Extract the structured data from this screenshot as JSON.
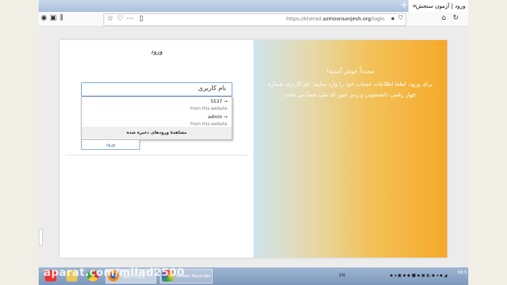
{
  "browser": {
    "tab_title": "ورود | آزمون سنجش - عضویت",
    "tab_close": "×",
    "new_tab": "+",
    "url_prefix": "https://kherad.",
    "url_domain": "azmoonsanjesh.org",
    "url_path": "/login"
  },
  "login": {
    "title": "ورود",
    "username_value": "نام کاربری",
    "autocomplete": [
      {
        "name": "5537",
        "source": "From this website"
      },
      {
        "name": "admin",
        "source": "From this website"
      }
    ],
    "view_saved_logins": "مشاهدهٔ ورودهای ذخیره شده",
    "submit_label": "ورود"
  },
  "welcome": {
    "heading": "مجدداً خوش آمدید!",
    "body": "برای ورود، لطفا اطلاعات حساب خود را وارد نمایید. نام کاربری شماره چهار رقمی دانشجویی و رمز عبور کد ملی شما می باشد"
  },
  "taskbar": {
    "firefox_label": "ورود | آزمون سنجش - Mo...",
    "recorder_label": "Screen Recorder",
    "lang": "EN",
    "time": "08:5"
  },
  "watermark": "aparat.com/milad2500"
}
